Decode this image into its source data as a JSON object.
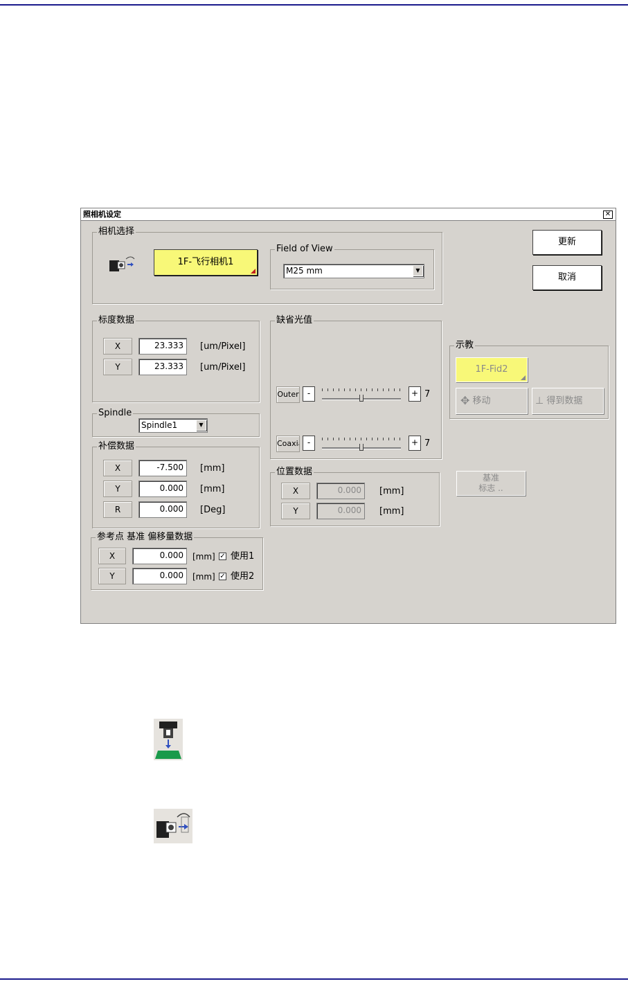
{
  "dialog": {
    "title": "照相机设定",
    "close_glyph": "✕"
  },
  "camera_select": {
    "legend": "相机选择",
    "camera_button": "1F-飞行相机1"
  },
  "field_of_view": {
    "legend": "Field of View",
    "value": "M25 mm"
  },
  "buttons": {
    "update": "更新",
    "cancel": "取消"
  },
  "scale_data": {
    "legend": "标度数据",
    "rows": [
      {
        "axis": "X",
        "value": "23.333",
        "unit": "[um/Pixel]"
      },
      {
        "axis": "Y",
        "value": "23.333",
        "unit": "[um/Pixel]"
      }
    ]
  },
  "spindle": {
    "legend": "Spindle",
    "value": "Spindle1"
  },
  "compensation": {
    "legend": "补偿数据",
    "rows": [
      {
        "axis": "X",
        "value": "-7.500",
        "unit": "[mm]"
      },
      {
        "axis": "Y",
        "value": "0.000",
        "unit": "[mm]"
      },
      {
        "axis": "R",
        "value": "0.000",
        "unit": "[Deg]"
      }
    ]
  },
  "reference_offset": {
    "legend": "参考点 基准 偏移量数据",
    "rows": [
      {
        "axis": "X",
        "value": "0.000",
        "unit": "[mm]",
        "check_label": "使用1",
        "checked": true
      },
      {
        "axis": "Y",
        "value": "0.000",
        "unit": "[mm]",
        "check_label": "使用2",
        "checked": true
      }
    ]
  },
  "default_light": {
    "legend": "缺省光值",
    "sliders": [
      {
        "label": "Outer",
        "minus": "-",
        "plus": "+",
        "value": "7",
        "level": 0.5
      },
      {
        "label": "Coaxia",
        "minus": "-",
        "plus": "+",
        "value": "7",
        "level": 0.5
      }
    ]
  },
  "position_data": {
    "legend": "位置数据",
    "rows": [
      {
        "axis": "X",
        "value": "0.000",
        "unit": "[mm]"
      },
      {
        "axis": "Y",
        "value": "0.000",
        "unit": "[mm]"
      }
    ]
  },
  "teach": {
    "legend": "示教",
    "fid_button": "1F-Fid2",
    "move_button": "移动",
    "get_data_button": "得到数据"
  },
  "fiducial_button": {
    "line1": "基准",
    "line2": "标志 .."
  }
}
